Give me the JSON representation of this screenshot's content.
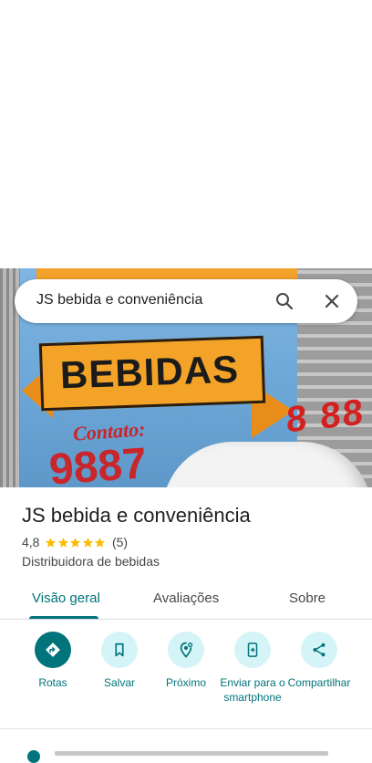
{
  "search": {
    "query": "JS bebida e conveniência"
  },
  "photo": {
    "banner_text": "BEBIDAS",
    "contact_label": "Contato:",
    "contact_number": "9887"
  },
  "place": {
    "name": "JS bebida e conveniência",
    "rating": "4,8",
    "stars": 5,
    "review_count": "(5)",
    "category": "Distribuidora de bebidas"
  },
  "tabs": [
    {
      "label": "Visão geral",
      "active": true
    },
    {
      "label": "Avaliações",
      "active": false
    },
    {
      "label": "Sobre",
      "active": false
    }
  ],
  "actions": [
    {
      "label": "Rotas",
      "icon": "directions-icon"
    },
    {
      "label": "Salvar",
      "icon": "bookmark-icon"
    },
    {
      "label": "Próximo",
      "icon": "nearby-icon"
    },
    {
      "label": "Enviar para o smartphone",
      "icon": "send-to-phone-icon"
    },
    {
      "label": "Compartilhar",
      "icon": "share-icon"
    }
  ],
  "colors": {
    "accent": "#00747a",
    "action_bg": "#d5f4f8",
    "star": "#fbbc04"
  }
}
